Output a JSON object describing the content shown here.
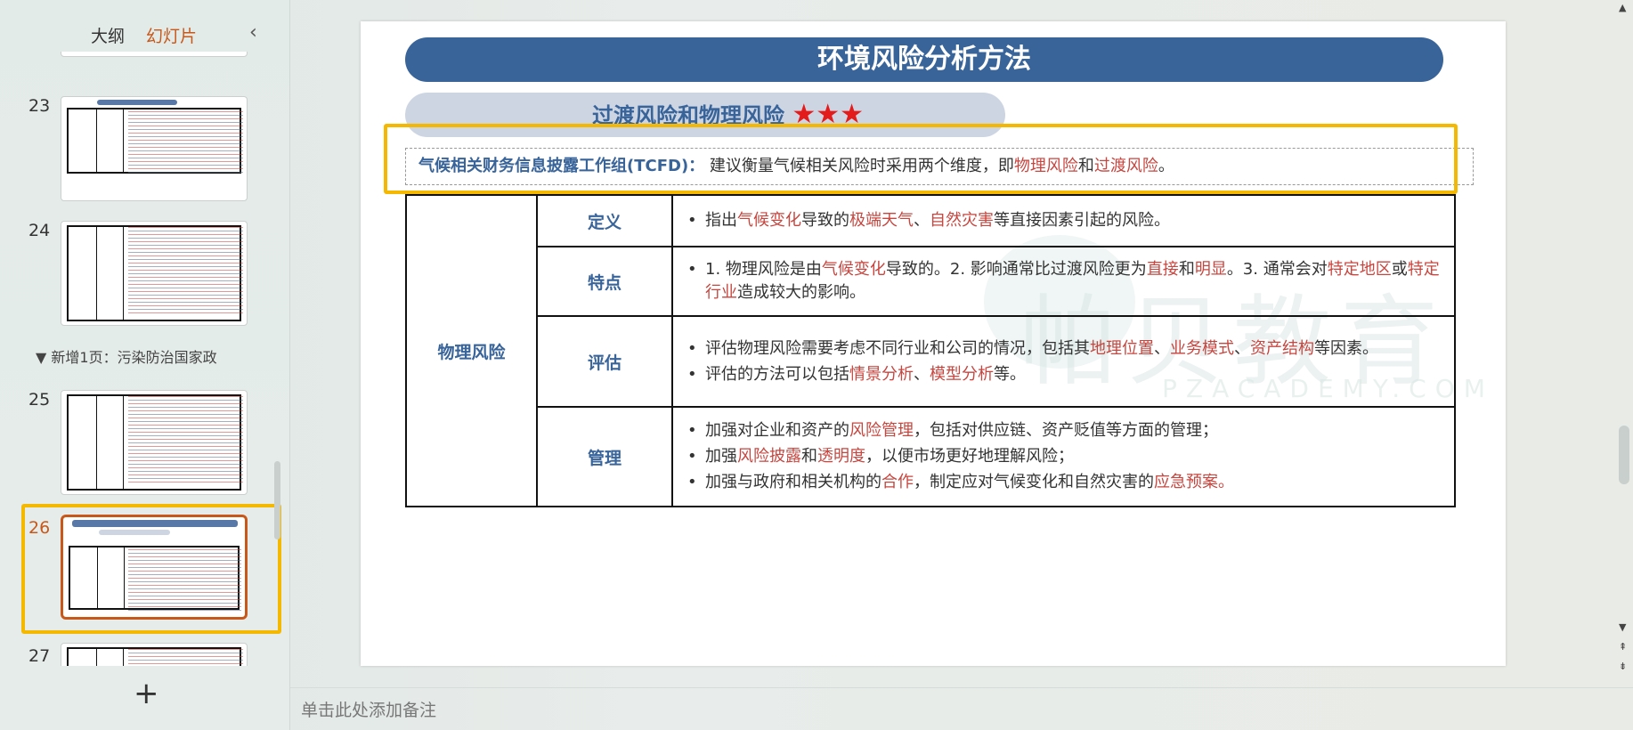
{
  "sidebar": {
    "tabs": [
      "大纲",
      "幻灯片"
    ],
    "active_tab": "幻灯片",
    "collapse_icon": "chevron-left-icon",
    "slides": [
      {
        "number": "23"
      },
      {
        "number": "24"
      },
      {
        "number": "25"
      },
      {
        "number": "26",
        "active": true
      },
      {
        "number": "27"
      }
    ],
    "section_label": "▼ 新增1页：污染防治国家政",
    "add_icon": "+"
  },
  "slide": {
    "title": "环境风险分析方法",
    "subtitle": "过渡风险和物理风险",
    "stars": "★★★",
    "tcfd": {
      "lead": "气候相关财务信息披露工作组(TCFD)：",
      "text1": "建议衡量气候相关风险时采用两个维度，即",
      "red1": "物理风险",
      "text2": "和",
      "red2": "过渡风险",
      "text3": "。"
    },
    "table": {
      "category": "物理风险",
      "rows": [
        {
          "label": "定义",
          "items": [
            [
              [
                "指出",
                ""
              ],
              [
                "气候变化",
                "red"
              ],
              [
                "导致的",
                ""
              ],
              [
                "极端天气",
                "red"
              ],
              [
                "、",
                ""
              ],
              [
                "自然灾害",
                "red"
              ],
              [
                "等直接因素引起的风险。",
                ""
              ]
            ]
          ]
        },
        {
          "label": "特点",
          "items": [
            [
              [
                "1.  物理风险是由",
                ""
              ],
              [
                "气候变化",
                "red"
              ],
              [
                "导致的。2.  影响通常比过渡风险更为",
                ""
              ],
              [
                "直接",
                "red"
              ],
              [
                "和",
                ""
              ],
              [
                "明显",
                "red"
              ],
              [
                "。3.  通常会对",
                ""
              ],
              [
                "特定地区",
                "red"
              ],
              [
                "或",
                ""
              ],
              [
                "特定行业",
                "red"
              ],
              [
                "造成较大的影响。",
                ""
              ]
            ]
          ]
        },
        {
          "label": "评估",
          "items": [
            [
              [
                "评估物理风险需要考虑不同行业和公司的情况，包括其",
                ""
              ],
              [
                "地理位置",
                "red"
              ],
              [
                "、",
                ""
              ],
              [
                "业务模式",
                "red"
              ],
              [
                "、",
                ""
              ],
              [
                "资产结构",
                "red"
              ],
              [
                "等因素。",
                ""
              ]
            ],
            [
              [
                "评估的方法可以包括",
                ""
              ],
              [
                "情景分析",
                "red"
              ],
              [
                "、",
                ""
              ],
              [
                "模型分析",
                "red"
              ],
              [
                "等。",
                ""
              ]
            ]
          ]
        },
        {
          "label": "管理",
          "items": [
            [
              [
                "加强对企业和资产的",
                ""
              ],
              [
                "风险管理",
                "red"
              ],
              [
                "，包括对供应链、资产贬值等方面的管理；",
                ""
              ]
            ],
            [
              [
                "加强",
                ""
              ],
              [
                "风险披露",
                "red"
              ],
              [
                "和",
                ""
              ],
              [
                "透明度",
                "red"
              ],
              [
                "，以便市场更好地理解风险；",
                ""
              ]
            ],
            [
              [
                "加强与政府和相关机构的",
                ""
              ],
              [
                "合作",
                "red"
              ],
              [
                "，制定应对气候变化和自然灾害的",
                ""
              ],
              [
                "应急预案",
                "red"
              ],
              [
                "。",
                "red"
              ]
            ]
          ]
        }
      ]
    },
    "watermark": "帕贝教育",
    "watermark_sub": "PZACADEMY.COM"
  },
  "notes": {
    "placeholder": "单击此处添加备注"
  },
  "colors": {
    "accent": "#c8581a",
    "title_blue": "#38649a",
    "highlight": "#f5b800",
    "red_text": "#c7463f"
  }
}
